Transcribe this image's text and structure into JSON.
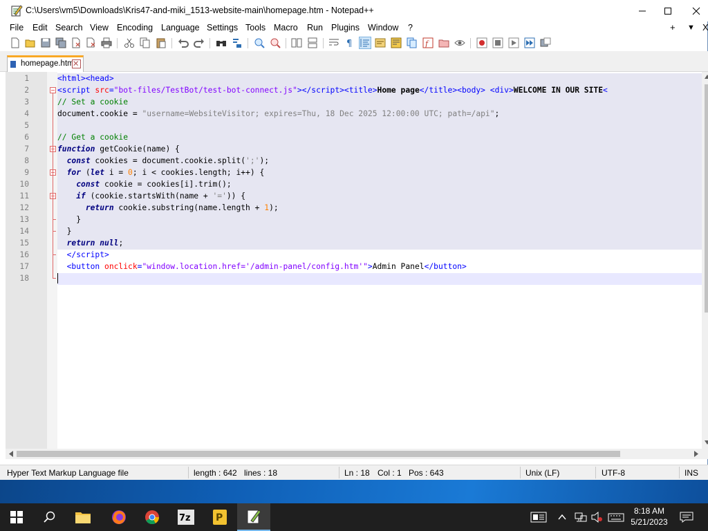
{
  "window": {
    "title": "C:\\Users\\vm5\\Downloads\\Kris47-and-miki_1513-website-main\\homepage.htm - Notepad++"
  },
  "menubar": {
    "items": [
      "File",
      "Edit",
      "Search",
      "View",
      "Encoding",
      "Language",
      "Settings",
      "Tools",
      "Macro",
      "Run",
      "Plugins",
      "Window",
      "?"
    ],
    "right_add": "+",
    "right_dropdown": "▼",
    "right_close": "X"
  },
  "tabs": [
    {
      "label": "homepage.htm"
    }
  ],
  "editor": {
    "line_numbers": [
      "1",
      "2",
      "3",
      "4",
      "5",
      "6",
      "7",
      "8",
      "9",
      "10",
      "11",
      "12",
      "13",
      "14",
      "15",
      "16",
      "17",
      "18"
    ]
  },
  "statusbar": {
    "file_type": "Hyper Text Markup Language file",
    "length": "length : 642",
    "lines": "lines : 18",
    "ln": "Ln : 18",
    "col": "Col : 1",
    "pos": "Pos : 643",
    "eol": "Unix (LF)",
    "encoding": "UTF-8",
    "mode": "INS"
  },
  "taskbar": {
    "time": "8:18 AM",
    "date": "5/21/2023",
    "apps": [
      "windows-start",
      "search",
      "file-explorer",
      "firefox",
      "chrome",
      "7zip",
      "notepad-yellow",
      "notepad-plus-plus"
    ]
  }
}
